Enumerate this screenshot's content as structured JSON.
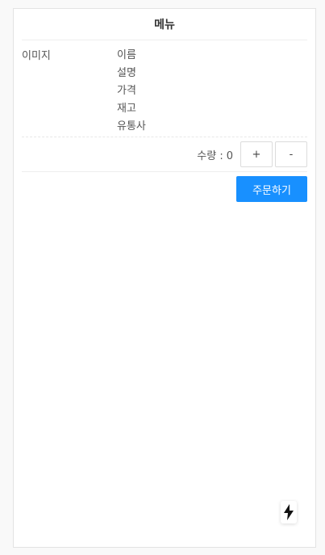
{
  "header": {
    "title": "메뉴"
  },
  "menu_item": {
    "image_label": "이미지",
    "name": "이름",
    "description": "설명",
    "price": "가격",
    "stock": "재고",
    "distributor": "유통사"
  },
  "quantity": {
    "label": "수량 :",
    "value": "0",
    "increment_label": "+",
    "decrement_label": "-"
  },
  "order": {
    "button_label": "주문하기"
  },
  "colors": {
    "primary": "#1890ff",
    "background": "#f9f9f9",
    "card": "#ffffff"
  },
  "icons": {
    "floating_action": "lightning-bolt-icon"
  }
}
